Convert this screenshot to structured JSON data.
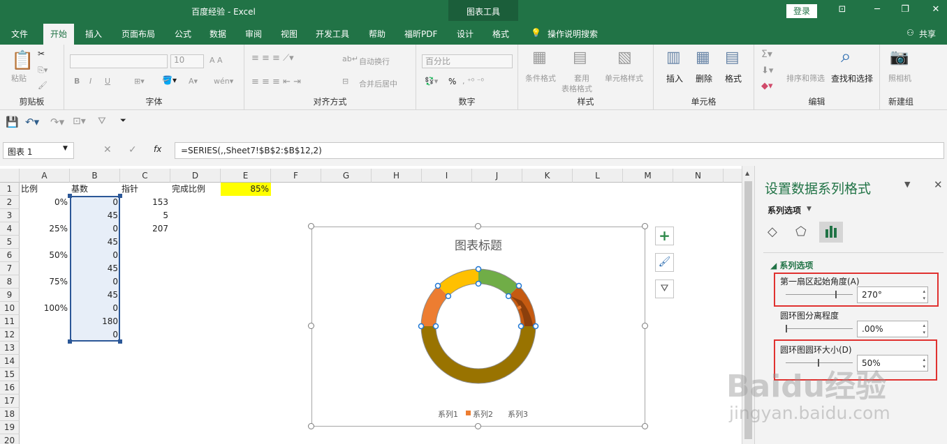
{
  "window": {
    "title": "百度经验  -  Excel",
    "context_tab": "图表工具",
    "login_label": "登录",
    "share_label": "共享"
  },
  "tabs": [
    "文件",
    "开始",
    "插入",
    "页面布局",
    "公式",
    "数据",
    "审阅",
    "视图",
    "开发工具",
    "帮助",
    "福昕PDF",
    "设计",
    "格式",
    "操作说明搜索"
  ],
  "ribbon": {
    "clipboard": {
      "paste": "粘贴",
      "label": "剪贴板"
    },
    "font": {
      "font_size": "10",
      "bold": "B",
      "italic": "I",
      "underline": "U",
      "label": "字体"
    },
    "align": {
      "wrap": "自动换行",
      "merge": "合并后居中",
      "label": "对齐方式"
    },
    "number": {
      "format": "百分比",
      "percent": "%",
      "label": "数字"
    },
    "styles": {
      "cond": "条件格式",
      "table_fmt_1": "套用",
      "table_fmt_2": "表格格式",
      "cell_style": "单元格样式",
      "label": "样式"
    },
    "cells": {
      "insert": "插入",
      "delete": "删除",
      "format": "格式",
      "label": "单元格"
    },
    "edit": {
      "sort": "排序和筛选",
      "find": "查找和选择",
      "label": "编辑"
    },
    "newgroup": {
      "camera": "照相机",
      "label": "新建组"
    }
  },
  "formula_bar": {
    "name_box": "图表 1",
    "formula": "=SERIES(,,Sheet7!$B$2:$B$12,2)",
    "fx": "fx"
  },
  "columns": [
    "A",
    "B",
    "C",
    "D",
    "E",
    "F",
    "G",
    "H",
    "I",
    "J",
    "K",
    "L",
    "M",
    "N"
  ],
  "rows": [
    "1",
    "2",
    "3",
    "4",
    "5",
    "6",
    "7",
    "8",
    "9",
    "10",
    "11",
    "12",
    "13",
    "14",
    "15",
    "16",
    "17",
    "18",
    "19",
    "20"
  ],
  "cells": {
    "A1": "比例",
    "B1": "基数",
    "C1": "指针",
    "D1": "完成比例",
    "E1": "85%",
    "A2": "0%",
    "B2": "0",
    "C2": "153",
    "B3": "45",
    "C3": "5",
    "A4": "25%",
    "B4": "0",
    "C4": "207",
    "B5": "45",
    "A6": "50%",
    "B6": "0",
    "B7": "45",
    "A8": "75%",
    "B8": "0",
    "B9": "45",
    "A10": "100%",
    "B10": "0",
    "B11": "180",
    "B12": "0"
  },
  "chart": {
    "title": "图表标题",
    "legend": [
      "系列1",
      "系列2",
      "系列3"
    ],
    "colors": {
      "orange": "#ED7D31",
      "gold": "#FFC000",
      "green": "#70AD47",
      "rust": "#C55A11",
      "olive": "#997300",
      "brown": "#843C0C"
    }
  },
  "chart_data": {
    "type": "pie",
    "title": "图表标题",
    "series": [
      {
        "name": "系列2",
        "hole": "50%",
        "first_slice_angle": 270,
        "values": [
          0,
          45,
          0,
          45,
          0,
          45,
          0,
          45,
          0,
          180,
          0
        ]
      },
      {
        "name": "系列3",
        "values": [
          153,
          5,
          207
        ]
      }
    ],
    "legend": [
      "系列1",
      "系列2",
      "系列3"
    ]
  },
  "pane": {
    "title": "设置数据系列格式",
    "options_label": "系列选项",
    "section": "系列选项",
    "angle_label": "第一扇区起始角度(A)",
    "angle_value": "270°",
    "explode_label": "圆环图分离程度",
    "explode_value": ".00%",
    "hole_label": "圆环图圆环大小(D)",
    "hole_value": "50%"
  },
  "watermark": {
    "brand": "Baidu经验",
    "url": "jingyan.baidu.com"
  }
}
